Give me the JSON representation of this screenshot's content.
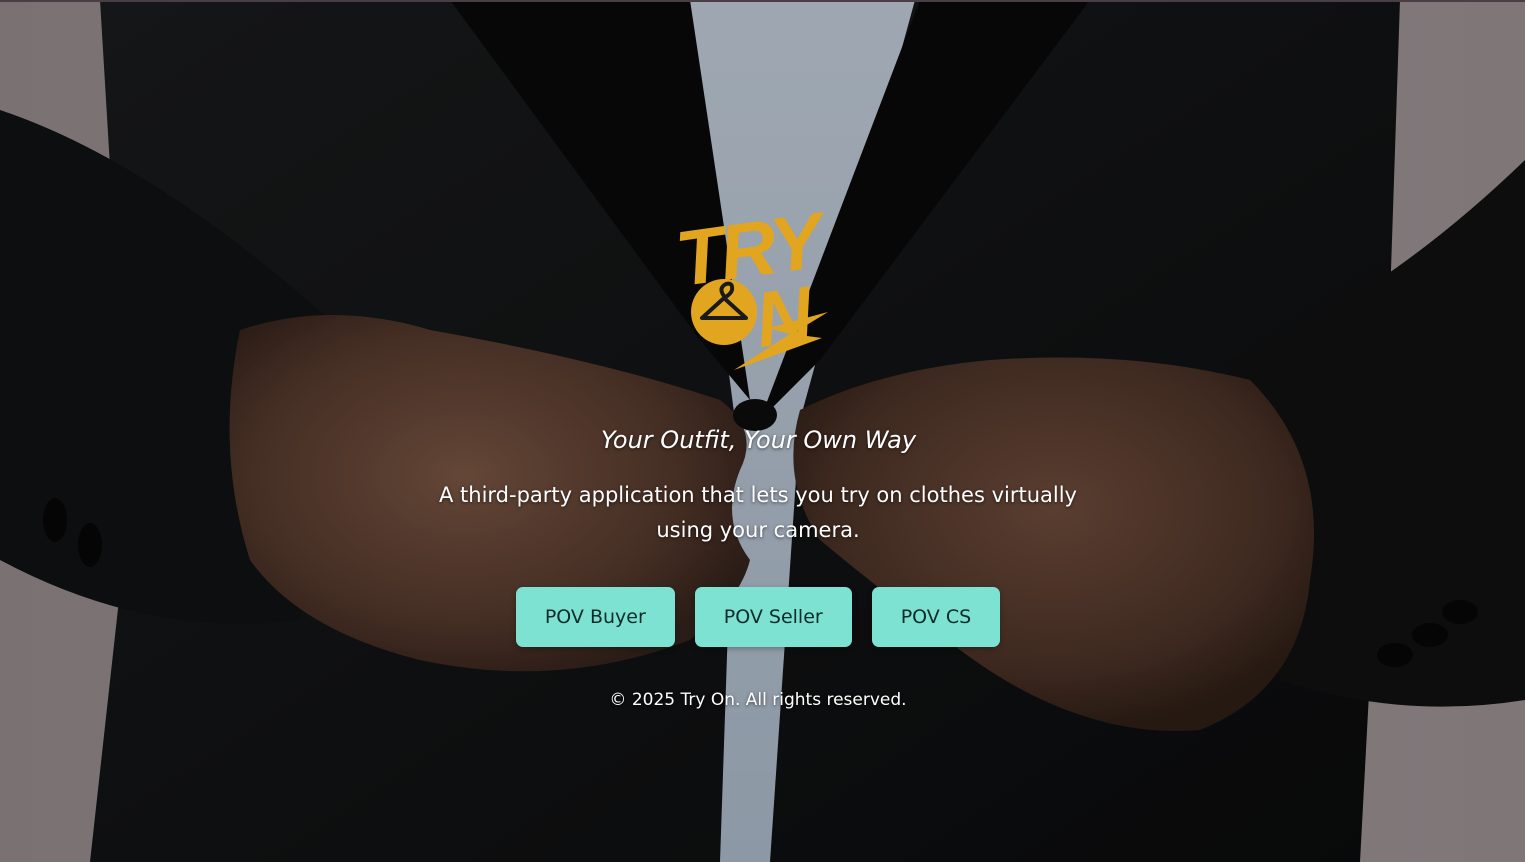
{
  "hero": {
    "background_description_colors": {
      "wall": "#b9acac",
      "jacket": "#111213",
      "shirt": "#d6e4f4",
      "skin": "#7a5542"
    }
  },
  "logo": {
    "alt_wordmark": "TRY ON",
    "color": "#e1a51f",
    "icon": "hanger-icon"
  },
  "tagline": "Your Outfit, Your Own Way",
  "description": "A third-party application that lets you try on clothes virtually using your camera.",
  "buttons": [
    {
      "label": "POV Buyer"
    },
    {
      "label": "POV Seller"
    },
    {
      "label": "POV CS"
    }
  ],
  "accent_color": "#7de2d1",
  "footer": {
    "copyright": "© 2025 Try On. All rights reserved."
  }
}
